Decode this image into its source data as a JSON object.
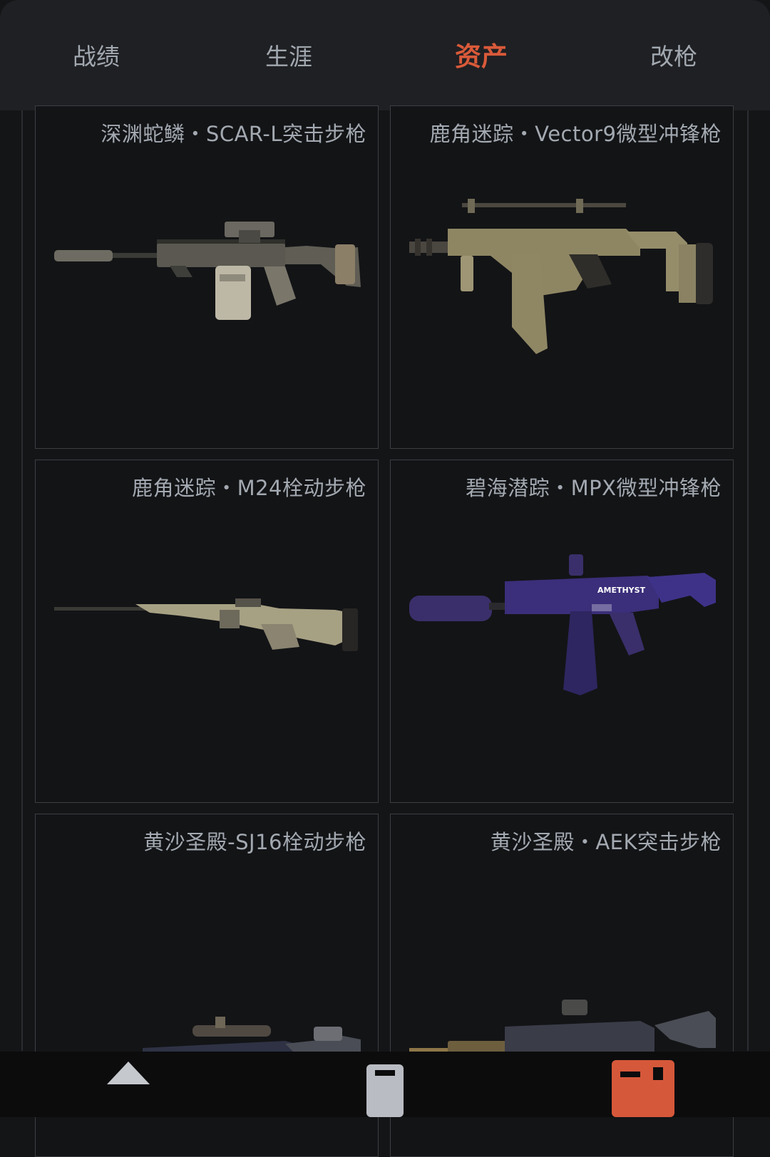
{
  "tabs": [
    {
      "label": "战绩",
      "active": false
    },
    {
      "label": "生涯",
      "active": false
    },
    {
      "label": "资产",
      "active": true
    },
    {
      "label": "改枪",
      "active": false
    }
  ],
  "accent_color": "#d6583a",
  "assets": [
    {
      "title": "深渊蛇鳞・SCAR-L突击步枪",
      "icon": "scar-l-rifle-icon"
    },
    {
      "title": "鹿角迷踪・Vector9微型冲锋枪",
      "icon": "vector-smg-icon"
    },
    {
      "title": "鹿角迷踪・M24栓动步枪",
      "icon": "m24-rifle-icon"
    },
    {
      "title": "碧海潜踪・MPX微型冲锋枪",
      "icon": "mpx-smg-icon",
      "decal_text": "AMETHYST"
    },
    {
      "title": "黄沙圣殿-SJ16栓动步枪",
      "icon": "sj16-sniper-icon"
    },
    {
      "title": "黄沙圣殿・AEK突击步枪",
      "icon": "aek-rifle-icon"
    }
  ],
  "bottom_nav": [
    {
      "icon": "home-icon"
    },
    {
      "icon": "inventory-icon"
    },
    {
      "icon": "profile-icon",
      "active": true
    }
  ]
}
